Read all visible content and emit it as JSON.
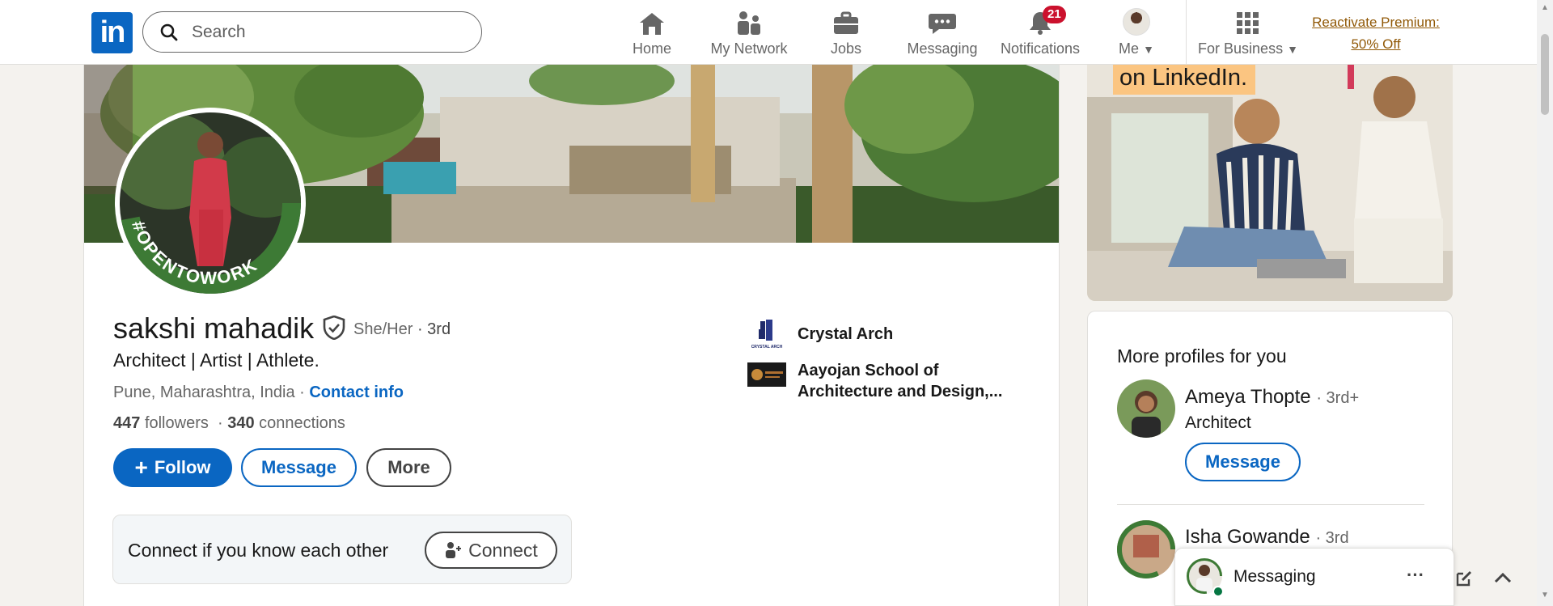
{
  "nav": {
    "logo_text": "in",
    "search_placeholder": "Search",
    "items": [
      {
        "label": "Home",
        "icon": "home-icon"
      },
      {
        "label": "My Network",
        "icon": "people-icon"
      },
      {
        "label": "Jobs",
        "icon": "briefcase-icon"
      },
      {
        "label": "Messaging",
        "icon": "chat-icon"
      },
      {
        "label": "Notifications",
        "icon": "bell-icon",
        "badge": "21"
      },
      {
        "label": "Me",
        "icon": "avatar"
      },
      {
        "label": "For Business",
        "icon": "grid-icon"
      }
    ],
    "premium_line1": "Reactivate Premium:",
    "premium_line2": "50% Off"
  },
  "profile": {
    "avatar_frame_text": "#OPENTOWORK",
    "name": "sakshi mahadik",
    "pronouns": "She/Her",
    "degree": "· 3rd",
    "headline": "Architect | Artist | Athlete.",
    "location": "Pune, Maharashtra, India ·",
    "contact_info": "Contact info",
    "followers_count": "447",
    "followers_label": "followers",
    "connections_count": "340",
    "connections_label": "connections",
    "follow_label": "Follow",
    "message_label": "Message",
    "more_label": "More",
    "connect_prompt": "Connect if you know each other",
    "connect_label": "Connect",
    "experience": [
      {
        "name": "Crystal Arch",
        "logo_text": "CRYSTAL ARCH"
      },
      {
        "name": "Aayojan School of Architecture and Design,..."
      }
    ]
  },
  "ad": {
    "tagline": "on LinkedIn."
  },
  "more_profiles": {
    "title": "More profiles for you",
    "people": [
      {
        "name": "Ameya Thopte",
        "degree": "· 3rd+",
        "title": "Architect",
        "button": "Message"
      },
      {
        "name": "Isha Gowande",
        "degree": "· 3rd"
      }
    ]
  },
  "messaging_bar": {
    "label": "Messaging"
  },
  "colors": {
    "brand": "#0a66c2",
    "premium": "#915907",
    "badge": "#cb112d",
    "opentowork": "#3d7a35"
  }
}
